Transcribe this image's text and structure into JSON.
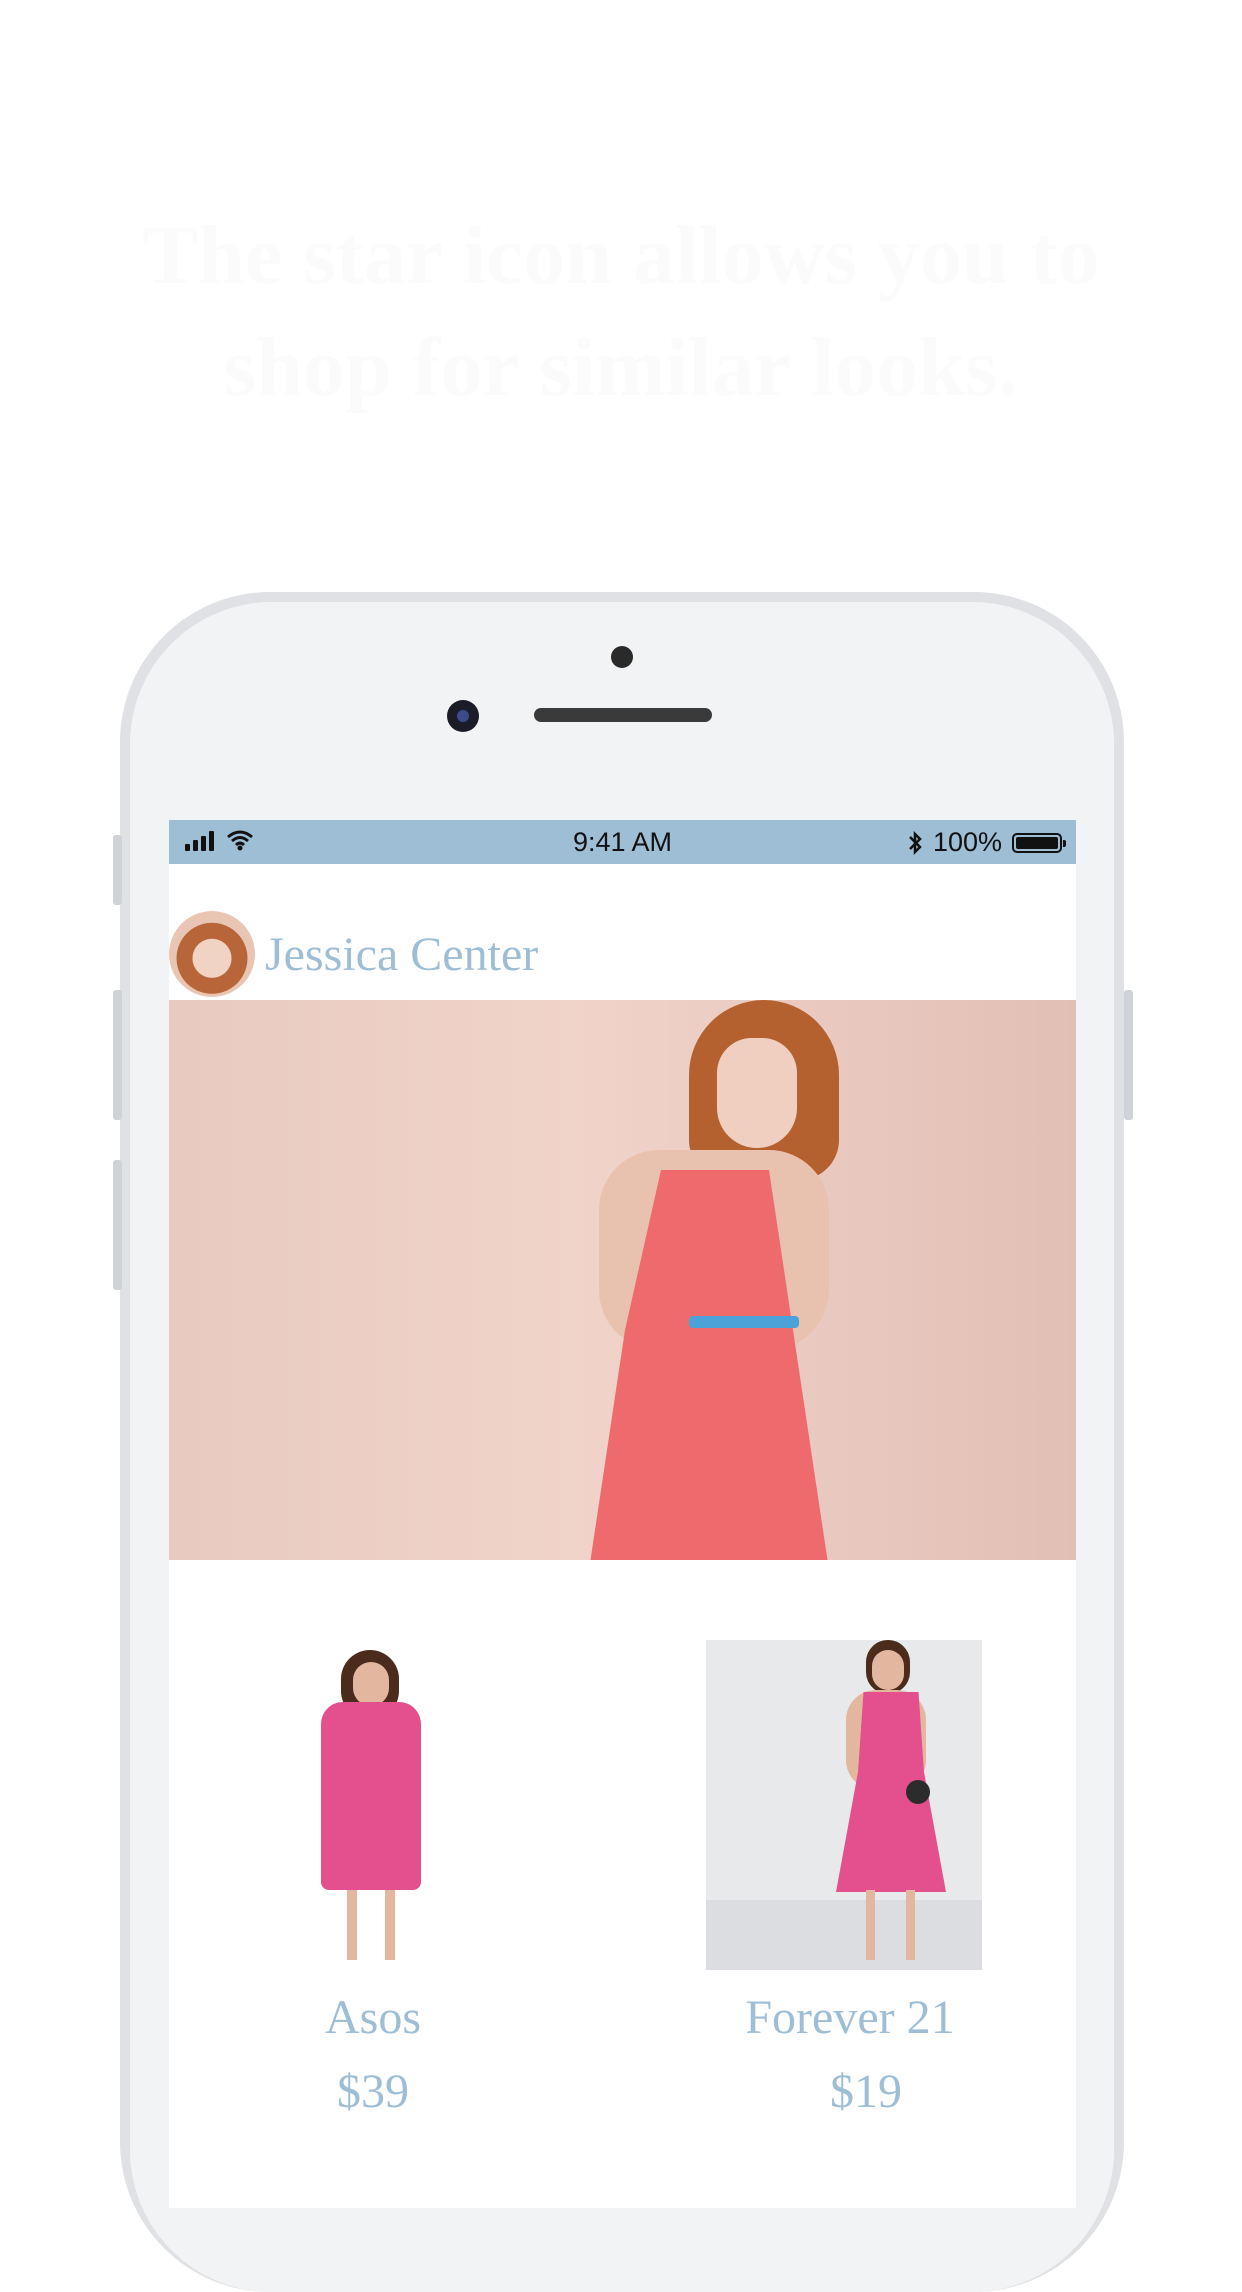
{
  "headline": "The star icon allows you to shop for similar looks.",
  "status_bar": {
    "time": "9:41 AM",
    "battery": "100%",
    "bluetooth_icon": "bluetooth-icon",
    "wifi_icon": "wifi-icon",
    "signal_icon": "signal-bars-icon"
  },
  "profile": {
    "name": "Jessica Center"
  },
  "products": [
    {
      "brand": "Asos",
      "price": "$39"
    },
    {
      "brand": "Forever 21",
      "price": "$19"
    }
  ],
  "colors": {
    "accent": "#9ebed5",
    "status_bar_bg": "#9ebed5",
    "dress": "#ef6a6c"
  }
}
